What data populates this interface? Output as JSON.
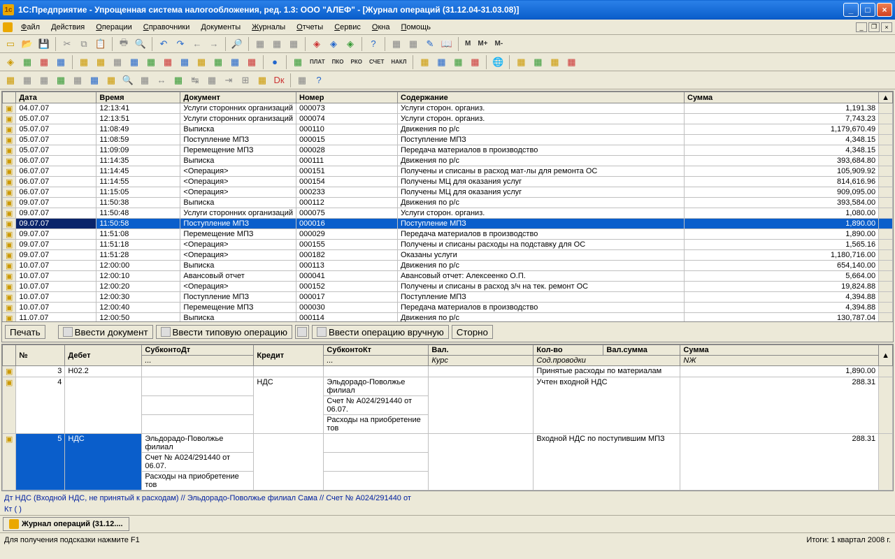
{
  "title": "1С:Предприятие - Упрощенная система налогообложения, ред. 1.3: ООО \"АЛЕФ\" - [Журнал операций  (31.12.04-31.03.08)]",
  "menu": [
    "Файл",
    "Действия",
    "Операции",
    "Справочники",
    "Документы",
    "Журналы",
    "Отчеты",
    "Сервис",
    "Окна",
    "Помощь"
  ],
  "m_labels": {
    "m": "М",
    "mp": "М+",
    "mm": "М-"
  },
  "columns": {
    "date": "Дата",
    "time": "Время",
    "doc": "Документ",
    "num": "Номер",
    "content": "Содержание",
    "sum": "Сумма"
  },
  "rows": [
    {
      "d": "04.07.07",
      "t": "12:13:41",
      "doc": "Услуги сторонних организаций",
      "n": "000073",
      "c": "Услуги сторон. организ.",
      "s": "1,191.38"
    },
    {
      "d": "05.07.07",
      "t": "12:13:51",
      "doc": "Услуги сторонних организаций",
      "n": "000074",
      "c": "Услуги сторон. организ.",
      "s": "7,743.23"
    },
    {
      "d": "05.07.07",
      "t": "11:08:49",
      "doc": "Выписка",
      "n": "000110",
      "c": "Движения по р/с",
      "s": "1,179,670.49"
    },
    {
      "d": "05.07.07",
      "t": "11:08:59",
      "doc": "Поступление МПЗ",
      "n": "000015",
      "c": "Поступление МПЗ",
      "s": "4,348.15"
    },
    {
      "d": "05.07.07",
      "t": "11:09:09",
      "doc": "Перемещение МПЗ",
      "n": "000028",
      "c": "Передача материалов в производство",
      "s": "4,348.15"
    },
    {
      "d": "06.07.07",
      "t": "11:14:35",
      "doc": "Выписка",
      "n": "000111",
      "c": "Движения по р/с",
      "s": "393,684.80"
    },
    {
      "d": "06.07.07",
      "t": "11:14:45",
      "doc": "<Операция>",
      "n": "000151",
      "c": "Получены и списаны в расход мат-лы для ремонта ОС",
      "s": "105,909.92"
    },
    {
      "d": "06.07.07",
      "t": "11:14:55",
      "doc": "<Операция>",
      "n": "000154",
      "c": "Получены МЦ для оказания услуг",
      "s": "814,616.96"
    },
    {
      "d": "06.07.07",
      "t": "11:15:05",
      "doc": "<Операция>",
      "n": "000233",
      "c": "Получены МЦ для оказания услуг",
      "s": "909,095.00"
    },
    {
      "d": "09.07.07",
      "t": "11:50:38",
      "doc": "Выписка",
      "n": "000112",
      "c": "Движения по р/с",
      "s": "393,584.00"
    },
    {
      "d": "09.07.07",
      "t": "11:50:48",
      "doc": "Услуги сторонних организаций",
      "n": "000075",
      "c": "Услуги сторон. организ.",
      "s": "1,080.00"
    },
    {
      "d": "09.07.07",
      "t": "11:50:58",
      "doc": "Поступление МПЗ",
      "n": "000016",
      "c": "Поступление МПЗ",
      "s": "1,890.00",
      "sel": true
    },
    {
      "d": "09.07.07",
      "t": "11:51:08",
      "doc": "Перемещение МПЗ",
      "n": "000029",
      "c": "Передача материалов в производство",
      "s": "1,890.00"
    },
    {
      "d": "09.07.07",
      "t": "11:51:18",
      "doc": "<Операция>",
      "n": "000155",
      "c": "Получены и списаны  расходы на подставку для ОС",
      "s": "1,565.16"
    },
    {
      "d": "09.07.07",
      "t": "11:51:28",
      "doc": "<Операция>",
      "n": "000182",
      "c": "Оказаны услуги",
      "s": "1,180,716.00"
    },
    {
      "d": "10.07.07",
      "t": "12:00:00",
      "doc": "Выписка",
      "n": "000113",
      "c": "Движения по р/с",
      "s": "654,140.00"
    },
    {
      "d": "10.07.07",
      "t": "12:00:10",
      "doc": "Авансовый отчет",
      "n": "000041",
      "c": "Авансовый отчет: Алексеенко О.П.",
      "s": "5,664.00"
    },
    {
      "d": "10.07.07",
      "t": "12:00:20",
      "doc": "<Операция>",
      "n": "000152",
      "c": "Получены и списаны в расход з/ч на тек. ремонт ОС",
      "s": "19,824.88"
    },
    {
      "d": "10.07.07",
      "t": "12:00:30",
      "doc": "Поступление МПЗ",
      "n": "000017",
      "c": "Поступление МПЗ",
      "s": "4,394.88"
    },
    {
      "d": "10.07.07",
      "t": "12:00:40",
      "doc": "Перемещение МПЗ",
      "n": "000030",
      "c": "Передача материалов в производство",
      "s": "4,394.88"
    },
    {
      "d": "11.07.07",
      "t": "12:00:50",
      "doc": "Выписка",
      "n": "000114",
      "c": "Движения по р/с",
      "s": "130,787.04"
    }
  ],
  "btns": {
    "print": "Печать",
    "newdoc": "Ввести документ",
    "newtyp": "Ввести типовую операцию",
    "newman": "Ввести операцию вручную",
    "storno": "Сторно"
  },
  "dcols": {
    "num": "№",
    "debet": "Дебет",
    "subdt": "СубконтоДт",
    "kredit": "Кредит",
    "subkt": "СубконтоКт",
    "val": "Вал.",
    "kolvo": "Кол-во",
    "valsum": "Вал.сумма",
    "sum": "Сумма",
    "kurs": "Курс",
    "sod": "Сод.проводки",
    "nzh": "NЖ",
    "dots": "..."
  },
  "drows": [
    {
      "n": "3",
      "deb": "Н02.2",
      "subdt": "",
      "kred": "",
      "subkt": "",
      "sod": "Принятые расходы по материалам",
      "sum": "1,890.00"
    },
    {
      "n": "4",
      "deb": "",
      "subdt": "",
      "kred": "НДС",
      "subkt": "Эльдорадо-Поволжье филиал\nСчет № А024/291440 от 06.07.\nРасходы на приобретение тов",
      "sod": "Учтен входной НДС",
      "sum": "288.31"
    },
    {
      "n": "5",
      "deb": "НДС",
      "subdt": "Эльдорадо-Поволжье филиал\nСчет № А024/291440 от 06.07.\nРасходы на приобретение тов",
      "kred": "",
      "subkt": "",
      "sod": "Входной НДС по поступившим МПЗ",
      "sum": "288.31",
      "sel": true
    }
  ],
  "info1": "Дт НДС (Входной НДС, не принятый к расходам) // Эльдорадо-Поволжье филиал Сама // Счет № А024/291440 от",
  "info2": "Кт ( )",
  "task": "Журнал операций  (31.12....",
  "status_l": "Для получения подсказки нажмите F1",
  "status_r": "Итоги: 1 квартал 2008 г."
}
